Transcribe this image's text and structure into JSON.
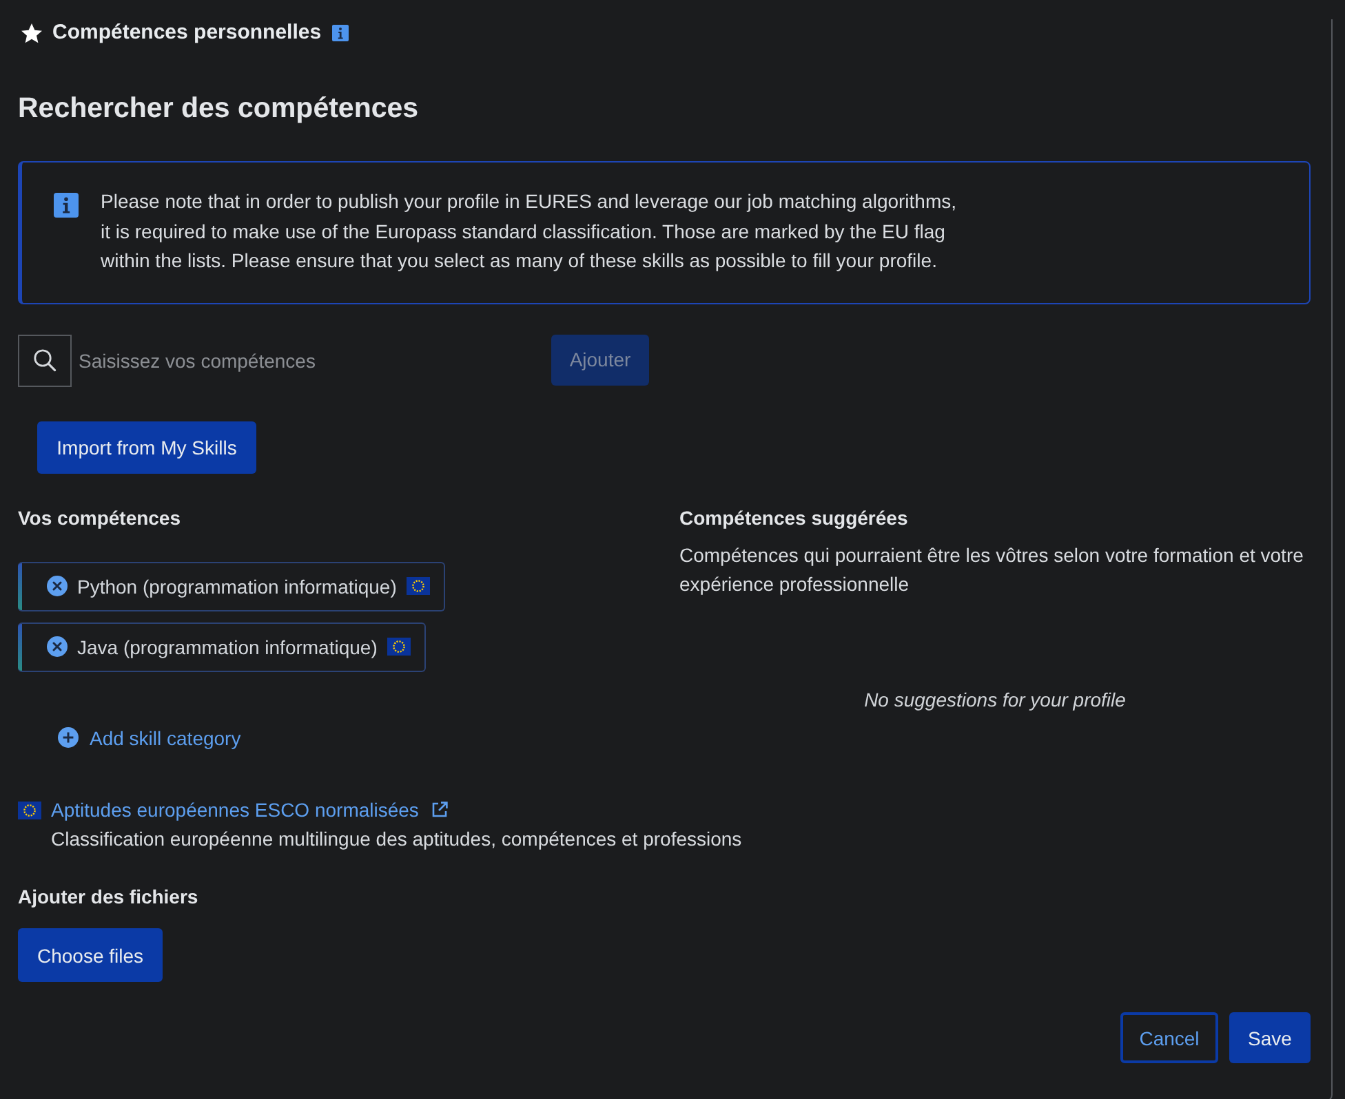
{
  "section": {
    "title": "Compétences personnelles"
  },
  "search_heading": "Rechercher des compétences",
  "notice": {
    "text": "Please note that in order to publish your profile in EURES and leverage our job matching algorithms, it is required to make use of the Europass standard classification. Those are marked by the EU flag within the lists. Please ensure that you select as many of these skills as possible to fill your profile."
  },
  "search": {
    "placeholder": "Saisissez vos compétences",
    "add_button": {
      "label": "Ajouter",
      "disabled": true
    }
  },
  "import_button": {
    "label": "Import from My Skills"
  },
  "your_skills": {
    "heading": "Vos compétences",
    "items": [
      {
        "label": "Python (programmation informatique)",
        "esco": true
      },
      {
        "label": "Java (programmation informatique)",
        "esco": true
      }
    ],
    "add_category": "Add skill category"
  },
  "suggested": {
    "heading": "Compétences suggérées",
    "description": "Compétences qui pourraient être les vôtres selon votre formation et votre expérience professionnelle",
    "empty_message": "No suggestions for your profile"
  },
  "esco_link": {
    "label": "Aptitudes européennes ESCO normalisées",
    "description": "Classification européenne multilingue des aptitudes, compétences et professions"
  },
  "files": {
    "heading": "Ajouter des fichiers",
    "button": "Choose files"
  },
  "actions": [
    {
      "label": "Cancel",
      "kind": "outline"
    },
    {
      "label": "Save",
      "kind": "primary"
    }
  ]
}
